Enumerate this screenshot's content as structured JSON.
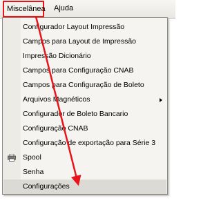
{
  "menubar": {
    "items": [
      {
        "label": "Miscelânea"
      },
      {
        "label": "Ajuda"
      }
    ]
  },
  "menu": {
    "items": [
      {
        "label": "Configurador Layout Impressão"
      },
      {
        "label": "Campos para Layout de Impressão"
      },
      {
        "label": "Impressão Dicionário"
      },
      {
        "label": "Campos para Configuração CNAB"
      },
      {
        "label": "Campos para Configuração de Boleto"
      },
      {
        "label": "Arquivos Magnéticos",
        "icon": "submenu-arrow-icon"
      },
      {
        "label": "Configurador de Boleto Bancario"
      },
      {
        "label": "Configuração CNAB"
      },
      {
        "label": "Configuração de exportação para Série 3"
      },
      {
        "label": "Spool",
        "icon": "printer-icon"
      },
      {
        "label": "Senha"
      },
      {
        "label": "Configurações"
      }
    ]
  },
  "annotation": {
    "color": "#e8141b"
  }
}
